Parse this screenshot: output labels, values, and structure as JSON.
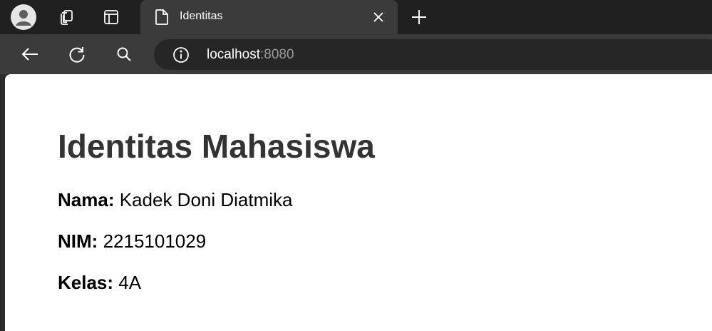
{
  "browser": {
    "tab": {
      "title": "Identitas"
    },
    "address": {
      "host": "localhost",
      "port": ":8080"
    }
  },
  "page": {
    "heading": "Identitas Mahasiswa",
    "fields": [
      {
        "label": "Nama:",
        "value": "Kadek Doni Diatmika"
      },
      {
        "label": "NIM:",
        "value": "2215101029"
      },
      {
        "label": "Kelas:",
        "value": "4A"
      }
    ]
  },
  "colors": {
    "tabstrip": "#202020",
    "toolbar": "#3b3b3b",
    "heading": "#333333"
  }
}
